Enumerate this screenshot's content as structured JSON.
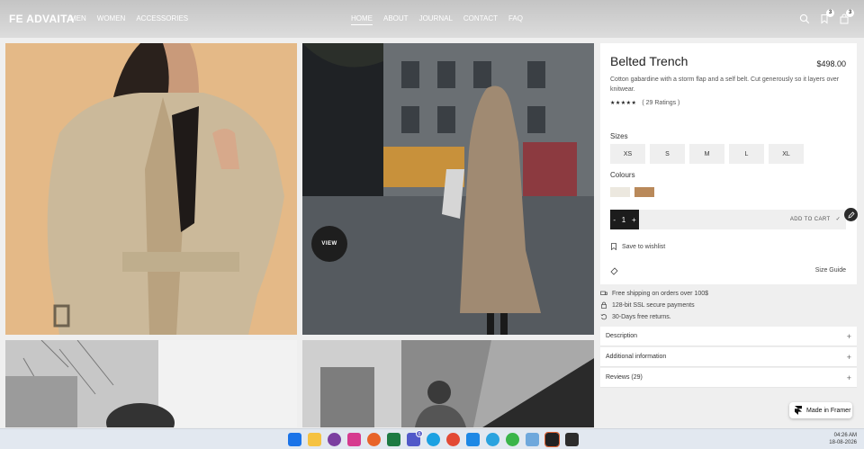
{
  "header": {
    "logo": "FE ADVAITA",
    "left_nav": [
      "MEN",
      "WOMEN",
      "ACCESSORIES"
    ],
    "center_nav": [
      "HOME",
      "ABOUT",
      "JOURNAL",
      "CONTACT",
      "FAQ"
    ],
    "active_nav": "HOME",
    "wishlist_count": "3",
    "cart_count": "3"
  },
  "gallery": {
    "view_label": "VIEW"
  },
  "product": {
    "title": "Belted Trench",
    "price": "$498.00",
    "description": "Cotton gabardine with a storm flap and a self belt. Cut generously so it layers over knitwear.",
    "stars": "★★★★★",
    "ratings": "( 29 Ratings )",
    "sizes_label": "Sizes",
    "sizes": [
      "XS",
      "S",
      "M",
      "L",
      "XL"
    ],
    "colours_label": "Colours",
    "colours": [
      "#ece8df",
      "#b9895a"
    ],
    "quantity": "1",
    "minus": "-",
    "plus": "+",
    "add_to_cart": "ADD TO CART",
    "wishlist": "Save to wishlist",
    "size_guide": "Size Guide"
  },
  "info": [
    "Free shipping on orders over 100$",
    "128-bit SSL secure payments",
    "30-Days free returns."
  ],
  "accordion": [
    "Description",
    "Additional information",
    "Reviews (29)"
  ],
  "framer_badge": "Made in Framer",
  "taskbar": {
    "time": "04:26 AM",
    "date": "18-08-2026",
    "notification_count": "6"
  }
}
